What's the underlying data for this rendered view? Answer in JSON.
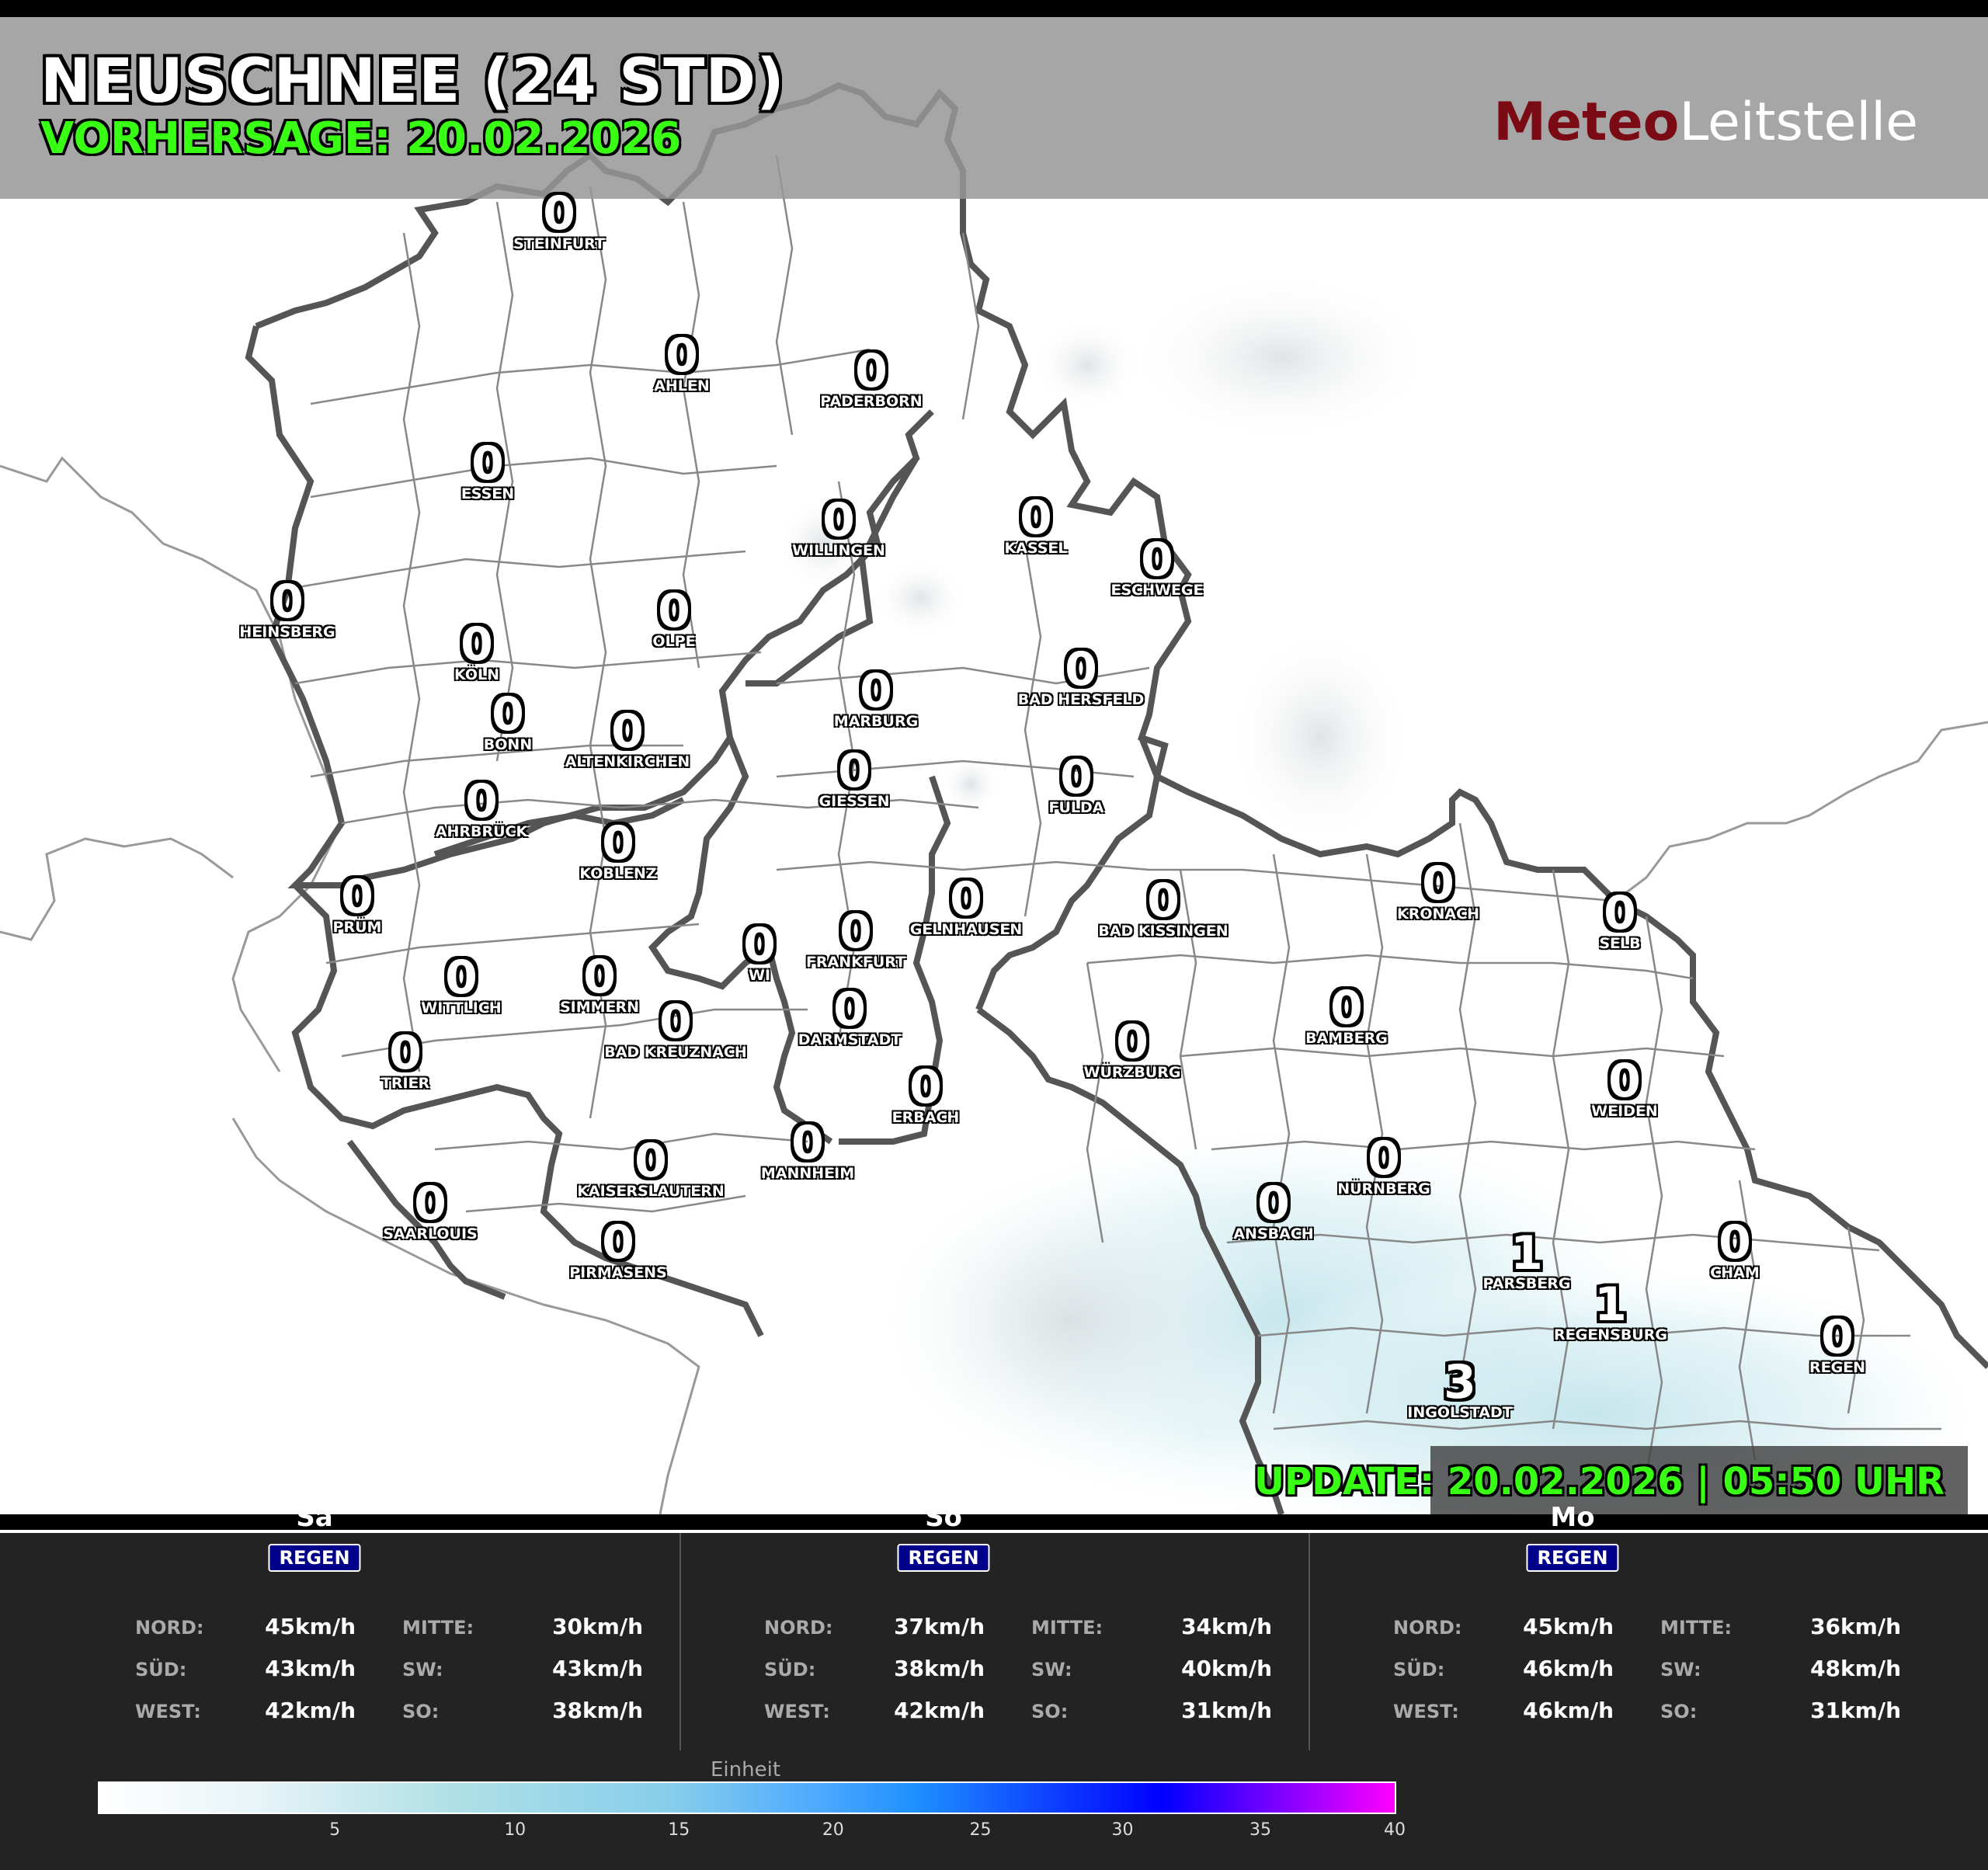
{
  "header": {
    "title": "NEUSCHNEE (24 STD)",
    "forecast": "VORHERSAGE: 20.02.2026",
    "brand_a": "Meteo",
    "brand_b": "Leitstelle"
  },
  "update": "UPDATE: 20.02.2026 | 05:50 UHR",
  "cities": [
    {
      "name": "STEINFURT",
      "value": "0"
    },
    {
      "name": "AHLEN",
      "value": "0"
    },
    {
      "name": "PADERBORN",
      "value": "0"
    },
    {
      "name": "ESSEN",
      "value": "0"
    },
    {
      "name": "WILLINGEN",
      "value": "0"
    },
    {
      "name": "KASSEL",
      "value": "0"
    },
    {
      "name": "ESCHWEGE",
      "value": "0"
    },
    {
      "name": "HEINSBERG",
      "value": "0"
    },
    {
      "name": "OLPE",
      "value": "0"
    },
    {
      "name": "KÖLN",
      "value": "0"
    },
    {
      "name": "MARBURG",
      "value": "0"
    },
    {
      "name": "BAD HERSFELD",
      "value": "0"
    },
    {
      "name": "BONN",
      "value": "0"
    },
    {
      "name": "ALTENKIRCHEN",
      "value": "0"
    },
    {
      "name": "GIESSEN",
      "value": "0"
    },
    {
      "name": "FULDA",
      "value": "0"
    },
    {
      "name": "AHRBRÜCK",
      "value": "0"
    },
    {
      "name": "KOBLENZ",
      "value": "0"
    },
    {
      "name": "PRÜM",
      "value": "0"
    },
    {
      "name": "GELNHAUSEN",
      "value": "0"
    },
    {
      "name": "BAD KISSINGEN",
      "value": "0"
    },
    {
      "name": "KRONACH",
      "value": "0"
    },
    {
      "name": "SELB",
      "value": "0"
    },
    {
      "name": "WI",
      "value": "0"
    },
    {
      "name": "FRANKFURT",
      "value": "0"
    },
    {
      "name": "WITTLICH",
      "value": "0"
    },
    {
      "name": "SIMMERN",
      "value": "0"
    },
    {
      "name": "BAD KREUZNACH",
      "value": "0"
    },
    {
      "name": "DARMSTADT",
      "value": "0"
    },
    {
      "name": "WÜRZBURG",
      "value": "0"
    },
    {
      "name": "BAMBERG",
      "value": "0"
    },
    {
      "name": "TRIER",
      "value": "0"
    },
    {
      "name": "ERBACH",
      "value": "0"
    },
    {
      "name": "WEIDEN",
      "value": "0"
    },
    {
      "name": "MANNHEIM",
      "value": "0"
    },
    {
      "name": "KAISERSLAUTERN",
      "value": "0"
    },
    {
      "name": "NÜRNBERG",
      "value": "0"
    },
    {
      "name": "SAARLOUIS",
      "value": "0"
    },
    {
      "name": "ANSBACH",
      "value": "0"
    },
    {
      "name": "PIRMASENS",
      "value": "0"
    },
    {
      "name": "PARSBERG",
      "value": "1"
    },
    {
      "name": "CHAM",
      "value": "0"
    },
    {
      "name": "REGENSBURG",
      "value": "1"
    },
    {
      "name": "REGEN",
      "value": "0"
    },
    {
      "name": "INGOLSTADT",
      "value": "3"
    }
  ],
  "days": [
    {
      "name": "Sa",
      "badge": "REGEN",
      "nord": "45km/h",
      "mitte": "30km/h",
      "sued": "43km/h",
      "sw": "43km/h",
      "west": "42km/h",
      "so": "38km/h"
    },
    {
      "name": "So",
      "badge": "REGEN",
      "nord": "37km/h",
      "mitte": "34km/h",
      "sued": "38km/h",
      "sw": "40km/h",
      "west": "42km/h",
      "so": "31km/h"
    },
    {
      "name": "Mo",
      "badge": "REGEN",
      "nord": "45km/h",
      "mitte": "36km/h",
      "sued": "46km/h",
      "sw": "48km/h",
      "west": "46km/h",
      "so": "31km/h"
    }
  ],
  "wind_labels": {
    "nord": "NORD:",
    "mitte": "MITTE:",
    "sued": "SÜD:",
    "sw": "SW:",
    "west": "WEST:",
    "so": "SO:"
  },
  "legend": {
    "title": "Einheit",
    "ticks": [
      "5",
      "10",
      "15",
      "20",
      "25",
      "30",
      "35",
      "40"
    ],
    "range": [
      0,
      40
    ],
    "colors": [
      "#ffffff",
      "#b0e0e6",
      "#87ceeb",
      "#1e90ff",
      "#0000ff",
      "#ff00ff"
    ]
  }
}
